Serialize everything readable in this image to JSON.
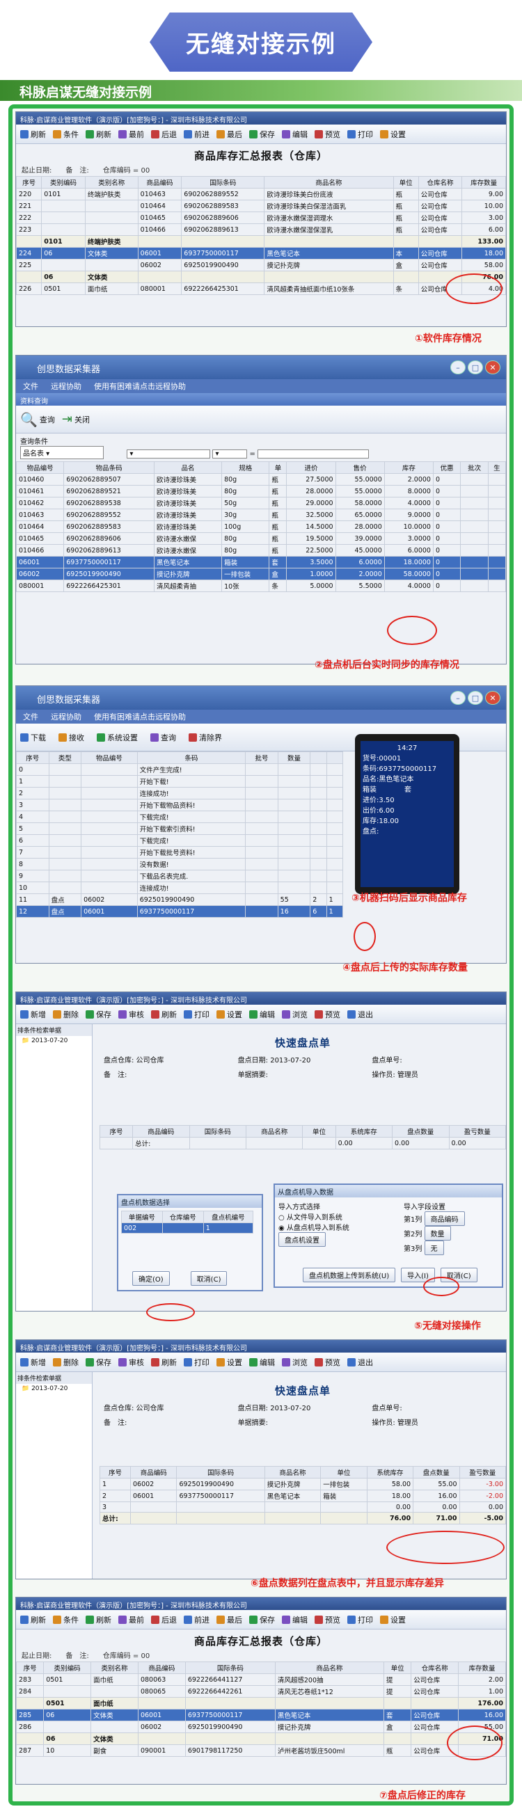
{
  "banner": {
    "title": "无缝对接示例"
  },
  "subtitle": "科脉启谋无缝对接示例",
  "shot1": {
    "wtitle": "科脉·启谋商业管理软件（演示版）[加密狗号：] - 深圳市科脉技术有限公司",
    "toolbar": [
      "刷新",
      "条件",
      "刷新",
      "最前",
      "后退",
      "前进",
      "最后",
      "保存",
      "编辑",
      "预览",
      "打印",
      "设置"
    ],
    "report_title": "商品库存汇总报表（仓库）",
    "meta": [
      "起止日期:",
      "备　注:",
      "仓库编码 = 00"
    ],
    "headers": [
      "序号",
      "类别编码",
      "类别名称",
      "商品编码",
      "国际条码",
      "商品名称",
      "单位",
      "仓库名称",
      "库存数量"
    ],
    "rows": [
      [
        "220",
        "0101",
        "终端护肤类",
        "010463",
        "6902062889552",
        "欧诗漫珍珠美白份底液",
        "瓶",
        "公司仓库",
        "9.00"
      ],
      [
        "221",
        "",
        "",
        "010464",
        "6902062889583",
        "欧诗漫珍珠美白保湿洁面乳",
        "瓶",
        "公司仓库",
        "10.00"
      ],
      [
        "222",
        "",
        "",
        "010465",
        "6902062889606",
        "欧诗漫水嫩保湿调理水",
        "瓶",
        "公司仓库",
        "3.00"
      ],
      [
        "223",
        "",
        "",
        "010466",
        "6902062889613",
        "欧诗漫水嫩保湿保湿乳",
        "瓶",
        "公司仓库",
        "6.00"
      ],
      [
        "",
        "0101",
        "终端护肤类",
        "",
        "",
        "",
        "",
        "",
        "133.00"
      ],
      [
        "224",
        "06",
        "文体类",
        "06001",
        "6937750000117",
        "黑色笔记本",
        "本",
        "公司仓库",
        "18.00"
      ],
      [
        "225",
        "",
        "",
        "06002",
        "6925019900490",
        "摸记扑克牌",
        "盒",
        "公司仓库",
        "58.00"
      ],
      [
        "",
        "06",
        "文体类",
        "",
        "",
        "",
        "",
        "",
        "76.00"
      ],
      [
        "226",
        "0501",
        "面巾纸",
        "080001",
        "6922266425301",
        "清风超柔青抽纸面巾纸10张条",
        "条",
        "公司仓库",
        "4.00"
      ]
    ],
    "ann": "①软件库存情况"
  },
  "shot2": {
    "wtitle": "创思数据采集器",
    "menu": [
      "文件",
      "远程协助",
      "使用有困难请点击远程协助"
    ],
    "sub": "资料查询",
    "buttons": [
      "查询",
      "关闭"
    ],
    "cond_label": "查询条件",
    "select": "品名表",
    "headers": [
      "物品编号",
      "物品条码",
      "品名",
      "规格",
      "单",
      "进价",
      "售价",
      "库存",
      "优惠",
      "批次",
      "生"
    ],
    "rows": [
      [
        "010460",
        "6902062889507",
        "欧诗漫珍珠美",
        "80g",
        "瓶",
        "27.5000",
        "55.0000",
        "2.0000",
        "0",
        "",
        ""
      ],
      [
        "010461",
        "6902062889521",
        "欧诗漫珍珠美",
        "80g",
        "瓶",
        "28.0000",
        "55.0000",
        "8.0000",
        "0",
        "",
        ""
      ],
      [
        "010462",
        "6902062889538",
        "欧诗漫珍珠美",
        "50g",
        "瓶",
        "29.0000",
        "58.0000",
        "4.0000",
        "0",
        "",
        ""
      ],
      [
        "010463",
        "6902062889552",
        "欧诗漫珍珠美",
        "30g",
        "瓶",
        "32.5000",
        "65.0000",
        "9.0000",
        "0",
        "",
        ""
      ],
      [
        "010464",
        "6902062889583",
        "欧诗漫珍珠美",
        "100g",
        "瓶",
        "14.5000",
        "28.0000",
        "10.0000",
        "0",
        "",
        ""
      ],
      [
        "010465",
        "6902062889606",
        "欧诗漫水嫩保",
        "80g",
        "瓶",
        "19.5000",
        "39.0000",
        "3.0000",
        "0",
        "",
        ""
      ],
      [
        "010466",
        "6902062889613",
        "欧诗漫水嫩保",
        "80g",
        "瓶",
        "22.5000",
        "45.0000",
        "6.0000",
        "0",
        "",
        ""
      ],
      [
        "06001",
        "6937750000117",
        "黑色笔记本",
        "箱装",
        "套",
        "3.5000",
        "6.0000",
        "18.0000",
        "0",
        "",
        ""
      ],
      [
        "06002",
        "6925019900490",
        "摸记扑克牌",
        "一排包装",
        "盒",
        "1.0000",
        "2.0000",
        "58.0000",
        "0",
        "",
        ""
      ],
      [
        "080001",
        "6922266425301",
        "清风超柔青抽",
        "10张",
        "条",
        "5.0000",
        "5.5000",
        "4.0000",
        "0",
        "",
        ""
      ]
    ],
    "ann": "②盘点机后台实时同步的库存情况"
  },
  "shot3": {
    "wtitle": "创思数据采集器",
    "menu": [
      "文件",
      "远程协助",
      "使用有困难请点击远程协助"
    ],
    "buttons": [
      "下载",
      "接收",
      "系统设置",
      "查询",
      "清除界"
    ],
    "headers": [
      "序号",
      "类型",
      "物品编号",
      "条码",
      "批号",
      "数量",
      "",
      ""
    ],
    "rows": [
      [
        "0",
        "",
        "",
        "文件产生完成!",
        "",
        "",
        "",
        ""
      ],
      [
        "1",
        "",
        "",
        "开始下载!",
        "",
        "",
        "",
        ""
      ],
      [
        "2",
        "",
        "",
        "连接成功!",
        "",
        "",
        "",
        ""
      ],
      [
        "3",
        "",
        "",
        "开始下载物品资料!",
        "",
        "",
        "",
        ""
      ],
      [
        "4",
        "",
        "",
        "下载完成!",
        "",
        "",
        "",
        ""
      ],
      [
        "5",
        "",
        "",
        "开始下载索引资料!",
        "",
        "",
        "",
        ""
      ],
      [
        "6",
        "",
        "",
        "下载完成!",
        "",
        "",
        "",
        ""
      ],
      [
        "7",
        "",
        "",
        "开始下载批号资料!",
        "",
        "",
        "",
        ""
      ],
      [
        "8",
        "",
        "",
        "没有数据!",
        "",
        "",
        "",
        ""
      ],
      [
        "9",
        "",
        "",
        "下载品名表完成.",
        "",
        "",
        "",
        ""
      ],
      [
        "10",
        "",
        "",
        "连接成功!",
        "",
        "",
        "",
        ""
      ],
      [
        "11",
        "盘点",
        "06002",
        "6925019900490",
        "",
        "55",
        "2",
        "1"
      ],
      [
        "12",
        "盘点",
        "06001",
        "6937750000117",
        "",
        "16",
        "6",
        "1"
      ]
    ],
    "device": {
      "time": "14:27",
      "lines": [
        "货号:00001",
        "条码:6937750000117",
        "品名:黑色笔记本",
        "箱装　　　　套",
        "进价:3.50",
        "出价:6.00",
        "库存:18.00",
        "盘点:"
      ]
    },
    "ann3": "③机器扫码后显示商品库存",
    "ann4": "④盘点后上传的实际库存数量"
  },
  "shot4": {
    "wtitle": "科脉·启谋商业管理软件（演示版）[加密狗号：] - 深圳市科脉技术有限公司",
    "toolbar": [
      "新增",
      "删除",
      "保存",
      "审核",
      "刷新",
      "打印",
      "设置",
      "编辑",
      "浏览",
      "预览",
      "退出"
    ],
    "tree": [
      "排条件检索单据",
      "2013-07-20"
    ],
    "title": "快速盘点单",
    "fields": [
      "盘点仓库: 公司仓库",
      "盘点日期: 2013-07-20",
      "盘点单号:",
      "备　注:",
      "单据摘要:",
      "操作员: 管理员"
    ],
    "headers": [
      "序号",
      "商品编码",
      "国际条码",
      "商品名称",
      "单位",
      "系统库存",
      "盘点数量",
      "盈亏数量"
    ],
    "total": "总计:",
    "dlg1": {
      "title": "盘点机数据选择",
      "headers": [
        "单据编号",
        "仓库编号",
        "盘点机编号"
      ],
      "row": [
        "002",
        "",
        "1"
      ],
      "ok": "确定(O)",
      "cancel": "取消(C)"
    },
    "dlg2": {
      "title": "从盘点机导入数据",
      "method": "导入方式选择",
      "opt1": "从文件导入到系统",
      "opt2": "从盘点机导入到系统",
      "setbtn": "盘点机设置",
      "col": "导入字段设置",
      "c1": "第1列",
      "c2": "第2列",
      "c3": "第3列",
      "v1": "商品编码",
      "v2": "数量",
      "v3": "无",
      "upload": "盘点机数据上传到系统(U)",
      "import": "导入(I)",
      "cancel": "取消(C)"
    },
    "ann": "⑤无缝对接操作"
  },
  "shot5": {
    "wtitle": "科脉·启谋商业管理软件（演示版）[加密狗号：] - 深圳市科脉技术有限公司",
    "title": "快速盘点单",
    "fields": [
      "盘点仓库: 公司仓库",
      "盘点日期: 2013-07-20",
      "盘点单号:",
      "备　注:",
      "单据摘要:",
      "操作员: 管理员"
    ],
    "headers": [
      "序号",
      "商品编码",
      "国际条码",
      "商品名称",
      "单位",
      "系统库存",
      "盘点数量",
      "盈亏数量"
    ],
    "rows": [
      [
        "1",
        "06002",
        "6925019900490",
        "摸记扑克牌",
        "一排包装",
        "58.00",
        "55.00",
        "-3.00"
      ],
      [
        "2",
        "06001",
        "6937750000117",
        "黑色笔记本",
        "箱装",
        "18.00",
        "16.00",
        "-2.00"
      ],
      [
        "3",
        "",
        "",
        "",
        "",
        "0.00",
        "0.00",
        "0.00"
      ]
    ],
    "total": [
      "总计:",
      "",
      "",
      "",
      "",
      "76.00",
      "71.00",
      "-5.00"
    ],
    "ann": "⑥盘点数据列在盘点表中，并且显示库存差异"
  },
  "shot6": {
    "wtitle": "科脉·启谋商业管理软件（演示版）[加密狗号：] - 深圳市科脉技术有限公司",
    "report_title": "商品库存汇总报表（仓库）",
    "meta": [
      "起止日期:",
      "备　注:",
      "仓库编码 = 00"
    ],
    "headers": [
      "序号",
      "类别编码",
      "类别名称",
      "商品编码",
      "国际条码",
      "商品名称",
      "单位",
      "仓库名称",
      "库存数量"
    ],
    "rows": [
      [
        "283",
        "0501",
        "面巾纸",
        "080063",
        "6922266441127",
        "清风超感200抽",
        "提",
        "公司仓库",
        "2.00"
      ],
      [
        "284",
        "",
        "",
        "080065",
        "6922266442261",
        "清风无芯卷纸1*12",
        "提",
        "公司仓库",
        "1.00"
      ],
      [
        "",
        "0501",
        "面巾纸",
        "",
        "",
        "",
        "",
        "",
        "176.00"
      ],
      [
        "285",
        "06",
        "文体类",
        "06001",
        "6937750000117",
        "黑色笔记本",
        "套",
        "公司仓库",
        "16.00"
      ],
      [
        "286",
        "",
        "",
        "06002",
        "6925019900490",
        "摸记扑克牌",
        "盒",
        "公司仓库",
        "55.00"
      ],
      [
        "",
        "06",
        "文体类",
        "",
        "",
        "",
        "",
        "",
        "71.00"
      ],
      [
        "287",
        "10",
        "副食",
        "090001",
        "6901798117250",
        "泸州老酱坊饭庄500ml",
        "瓶",
        "公司仓库",
        ""
      ]
    ],
    "ann": "⑦盘点后修正的库存"
  }
}
